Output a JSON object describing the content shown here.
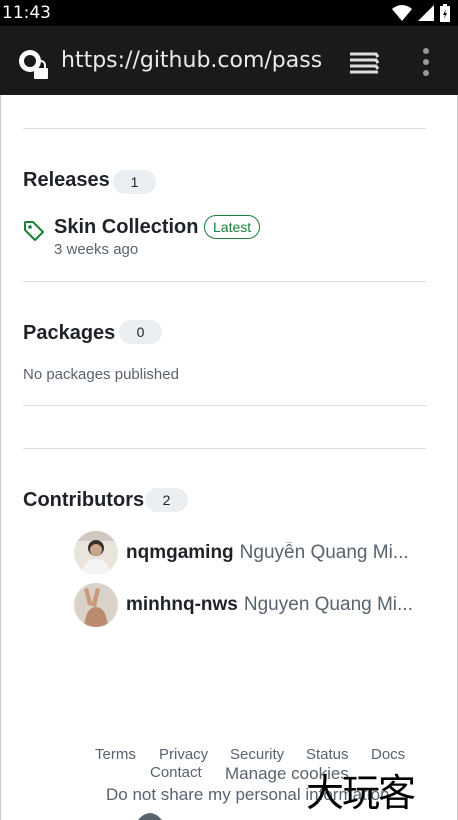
{
  "status_bar": {
    "time": "11:43"
  },
  "browser": {
    "url": "https://github.com/pass-"
  },
  "releases": {
    "title": "Releases",
    "count": "1",
    "latest": {
      "name": "Skin Collection",
      "badge": "Latest",
      "time": "3 weeks ago"
    }
  },
  "packages": {
    "title": "Packages",
    "count": "0",
    "empty_text": "No packages published"
  },
  "contributors": {
    "title": "Contributors",
    "count": "2",
    "items": [
      {
        "login": "nqmgaming",
        "fullname": "Nguyễn Quang Mi..."
      },
      {
        "login": "minhnq-nws",
        "fullname": "Nguyen Quang Mi..."
      }
    ]
  },
  "footer": {
    "links": [
      "Terms",
      "Privacy",
      "Security",
      "Status",
      "Docs",
      "Contact",
      "Manage cookies"
    ],
    "do_not_share": "Do not share my personal information"
  },
  "watermark": "大玩客",
  "colors": {
    "accent_green": "#1a7f37",
    "text": "#1f2328",
    "muted": "#59636e",
    "counter_bg": "#eceff2"
  }
}
